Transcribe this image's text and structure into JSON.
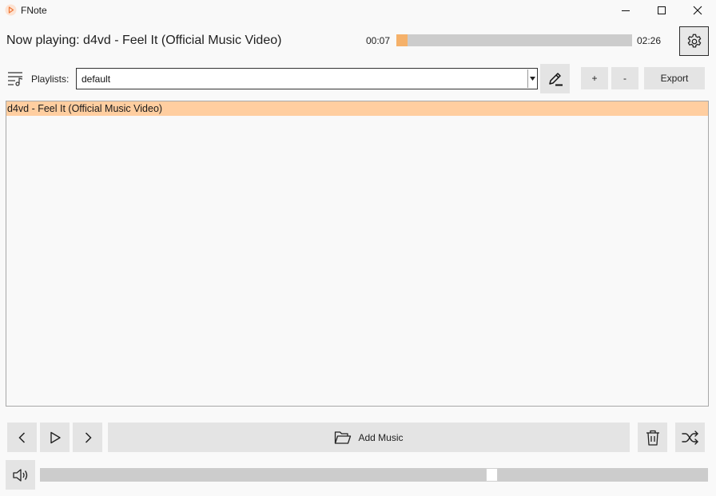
{
  "window": {
    "title": "FNote",
    "controls": [
      "minimize-icon",
      "maximize-icon",
      "close-icon"
    ]
  },
  "player": {
    "now_playing": "Now playing: d4vd - Feel It (Official Music Video)",
    "current_time": "00:07",
    "total_time": "02:26",
    "progress_fraction": 0.048,
    "settings_icon": "gear-icon"
  },
  "playlist": {
    "label": "Playlists:",
    "selected": "default",
    "add_label": "+",
    "remove_label": "-",
    "export_label": "Export",
    "edit_icon": "pen-icon"
  },
  "tracks": [
    {
      "title": "d4vd - Feel It (Official Music Video)",
      "selected": true
    }
  ],
  "controls": {
    "add_music_label": "Add Music",
    "prev_icon": "chevron-left-icon",
    "play_icon": "play-icon",
    "next_icon": "chevron-right-icon",
    "delete_icon": "trash-icon",
    "shuffle_icon": "shuffle-icon",
    "folder_icon": "folder-open-icon"
  },
  "volume": {
    "icon": "speaker-icon",
    "level_fraction": 0.68
  },
  "colors": {
    "accent": "#f5b16a",
    "selected_row": "#ffcea0",
    "button_bg": "#e4e4e4"
  }
}
